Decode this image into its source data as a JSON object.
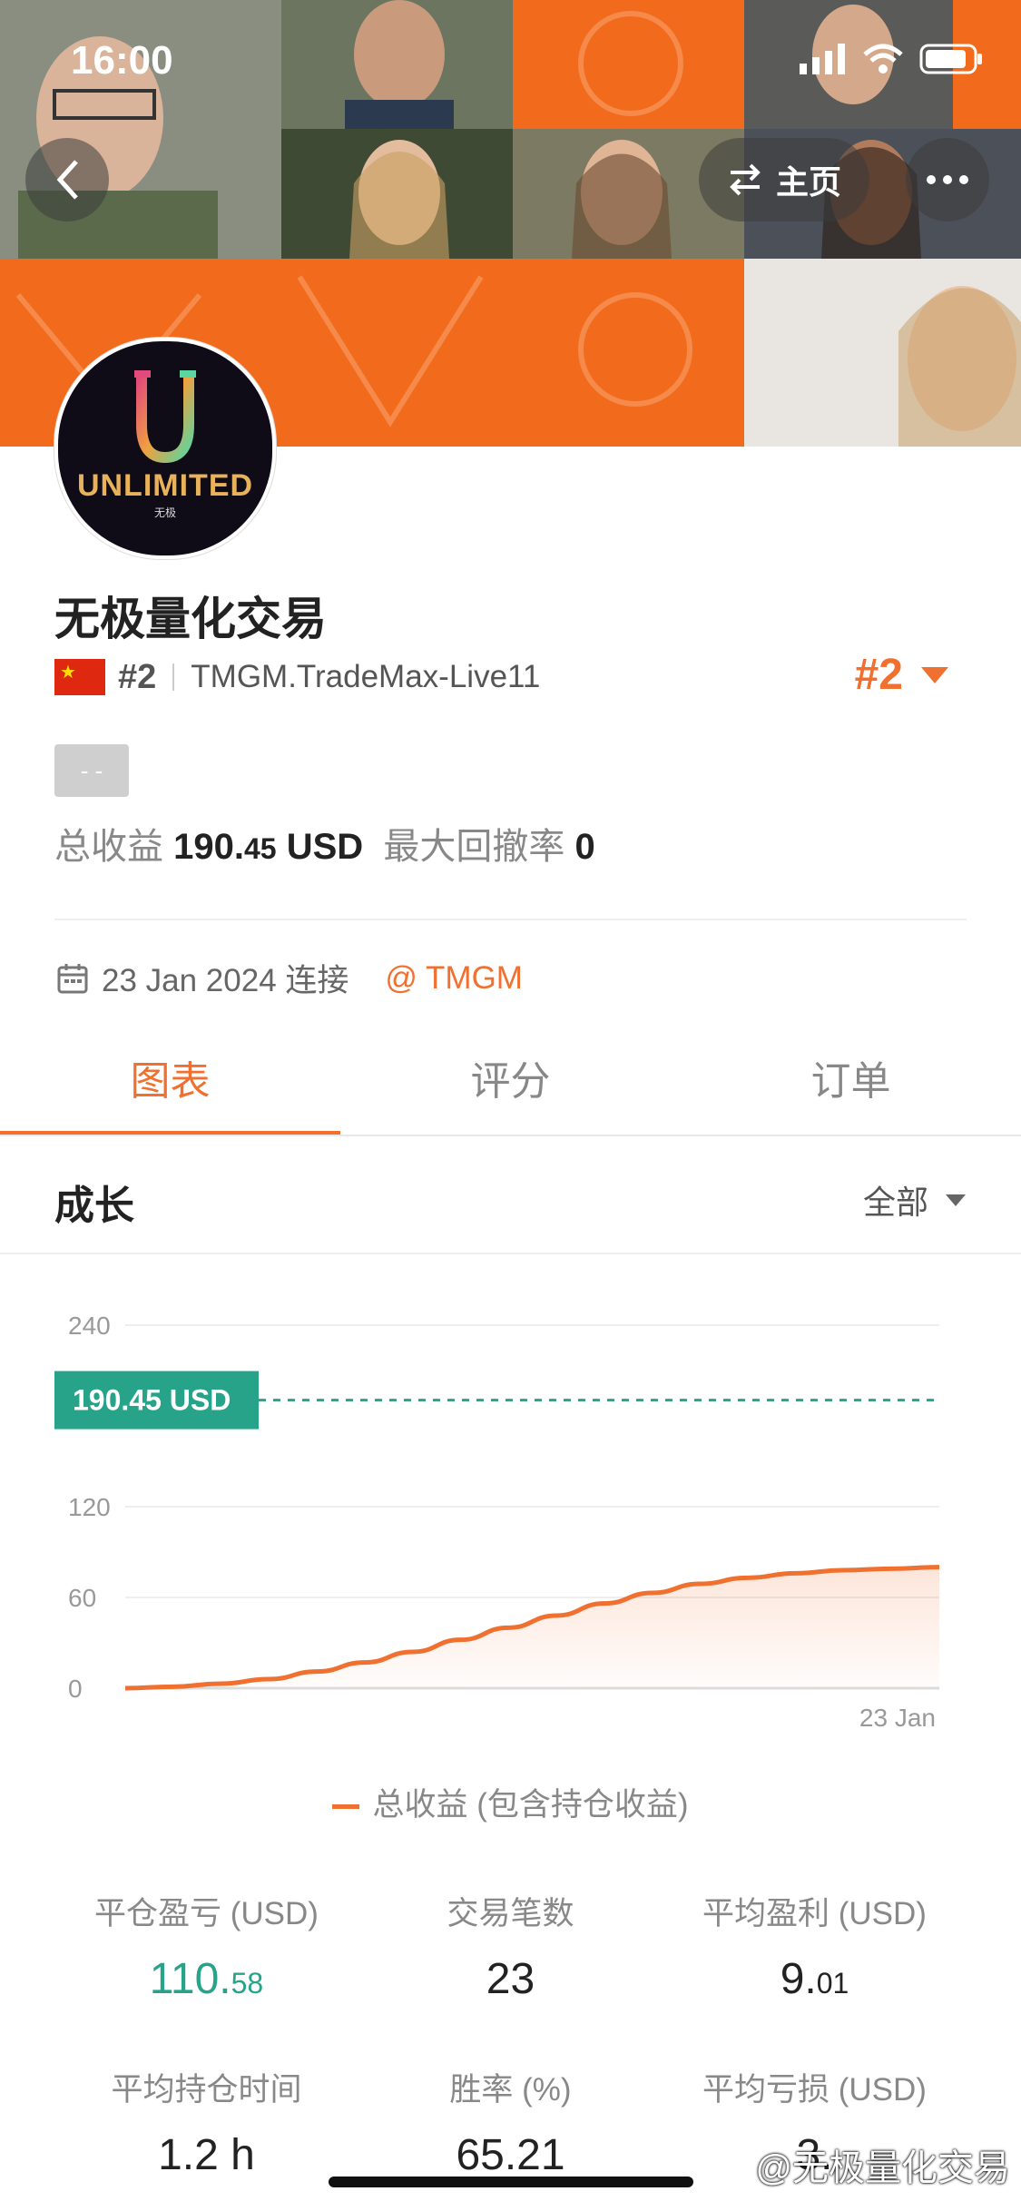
{
  "status_bar": {
    "time": "16:00"
  },
  "nav": {
    "home_label": "主页"
  },
  "avatar": {
    "logo_text": "UNLIMITED",
    "logo_sub": "无极"
  },
  "profile": {
    "name": "无极量化交易",
    "rank_small": "#2",
    "server": "TMGM.TradeMax-Live11",
    "rank_big": "#2",
    "tag": "- -",
    "total_profit_label": "总收益",
    "total_profit_int": "190.",
    "total_profit_dec": "45",
    "total_profit_unit": "USD",
    "max_drawdown_label": "最大回撤率",
    "max_drawdown_value": "0",
    "connected_date": "23 Jan 2024 连接",
    "broker": "@ TMGM"
  },
  "tabs": [
    {
      "label": "图表",
      "active": true
    },
    {
      "label": "评分",
      "active": false
    },
    {
      "label": "订单",
      "active": false
    }
  ],
  "growth": {
    "title": "成长",
    "filter": "全部"
  },
  "chart_data": {
    "type": "line",
    "y_ticks": [
      "240",
      "120",
      "60",
      "0"
    ],
    "ylim": [
      0,
      240
    ],
    "x_label_end": "23 Jan",
    "current_value_label": "190.45 USD",
    "current_value": 190.45,
    "series": [
      {
        "name": "总收益 (包含持仓收益)",
        "color": "#f07030",
        "values": [
          0,
          1,
          3,
          6,
          11,
          17,
          24,
          32,
          40,
          48,
          56,
          63,
          69,
          73,
          76,
          78,
          79,
          80
        ]
      }
    ],
    "legend_label": "总收益 (包含持仓收益)"
  },
  "metrics": [
    {
      "label": "平仓盈亏 (USD)",
      "int": "110.",
      "dec": "58",
      "color": "green"
    },
    {
      "label": "交易笔数",
      "int": "23",
      "dec": "",
      "color": "default"
    },
    {
      "label": "平均盈利 (USD)",
      "int": "9.",
      "dec": "01",
      "color": "default"
    },
    {
      "label": "平均持仓时间",
      "int": "1.2 h",
      "dec": "",
      "color": "default"
    },
    {
      "label": "胜率 (%)",
      "int": "65.21",
      "dec": "",
      "color": "default"
    },
    {
      "label": "平均亏损 (USD)",
      "int": "3.",
      "dec": "",
      "color": "default"
    }
  ],
  "watermark": "@无极量化交易",
  "colors": {
    "accent": "#f07030",
    "positive": "#27a38a",
    "banner_orange": "#f26a1b"
  }
}
